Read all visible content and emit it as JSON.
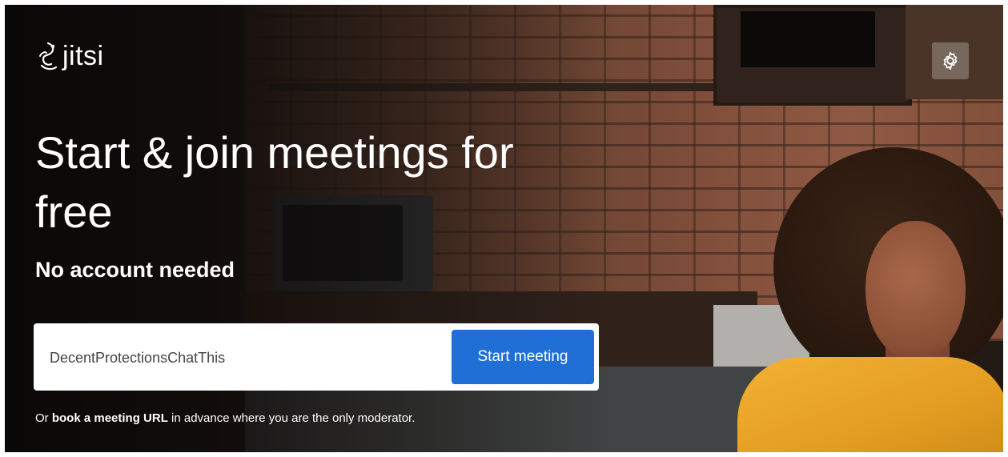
{
  "brand": {
    "name": "jitsi"
  },
  "header": {
    "settings_icon": "gear-icon"
  },
  "hero": {
    "title": "Start & join meetings for free",
    "subtitle": "No account needed"
  },
  "join": {
    "room_value": "DecentProtectionsChatThis",
    "start_button_label": "Start meeting"
  },
  "footnote": {
    "prefix": "Or ",
    "link_text": "book a meeting URL",
    "suffix": " in advance where you are the only moderator."
  },
  "colors": {
    "accent": "#1f6fd6",
    "text": "#ffffff"
  }
}
